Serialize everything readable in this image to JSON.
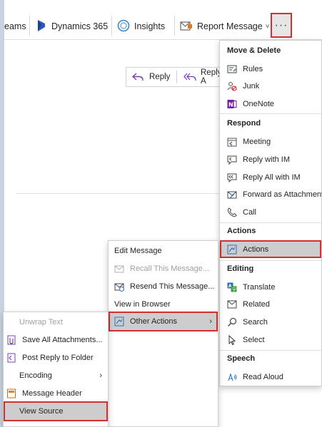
{
  "toolbar": {
    "teams_partial": "eams",
    "dynamics": "Dynamics 365",
    "insights": "Insights",
    "report": "Report Message",
    "report_caret": "˅",
    "more": "···"
  },
  "reply_bar": {
    "reply": "Reply",
    "reply_all": "Reply A"
  },
  "main_menu": {
    "move_delete": {
      "header": "Move & Delete",
      "items": [
        "Rules",
        "Junk",
        "OneNote"
      ]
    },
    "respond": {
      "header": "Respond",
      "items": [
        "Meeting",
        "Reply with IM",
        "Reply All with IM",
        "Forward as Attachment",
        "Call"
      ]
    },
    "actions": {
      "header": "Actions",
      "items": [
        "Actions"
      ]
    },
    "editing": {
      "header": "Editing",
      "items": [
        "Translate",
        "Related",
        "Search",
        "Select"
      ]
    },
    "speech": {
      "header": "Speech",
      "items": [
        "Read Aloud"
      ]
    }
  },
  "actions_submenu": {
    "items": [
      "Edit Message",
      "Recall This Message...",
      "Resend This Message...",
      "View in Browser",
      "Other Actions"
    ]
  },
  "other_actions_submenu": {
    "items": [
      "Unwrap Text",
      "Save All Attachments...",
      "Post Reply to Folder",
      "Encoding",
      "Message Header",
      "View Source"
    ]
  },
  "colors": {
    "highlight_border": "#d03030",
    "hover_bg": "#cdcdcd",
    "dynamics_blue": "#2a5bb8",
    "onenote_purple": "#7719aa"
  }
}
